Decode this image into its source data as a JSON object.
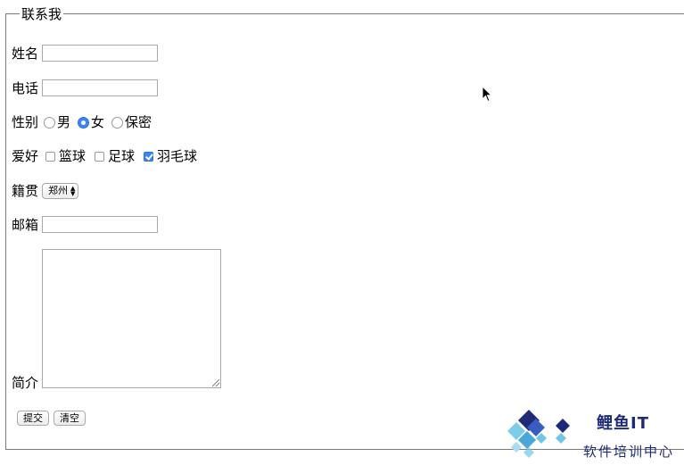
{
  "form": {
    "legend": "联系我",
    "name": {
      "label": "姓名",
      "value": ""
    },
    "phone": {
      "label": "电话",
      "value": ""
    },
    "gender": {
      "label": "性别",
      "options": [
        "男",
        "女",
        "保密"
      ],
      "selected": "女"
    },
    "hobbies": {
      "label": "爱好",
      "options": [
        "篮球",
        "足球",
        "羽毛球"
      ],
      "checked": [
        "羽毛球"
      ]
    },
    "hometown": {
      "label": "籍贯",
      "selected": "郑州"
    },
    "email": {
      "label": "邮箱",
      "value": ""
    },
    "intro": {
      "label": "简介",
      "value": ""
    },
    "submit_label": "提交",
    "reset_label": "清空"
  },
  "watermark": {
    "title": "鲤鱼IT",
    "subtitle": "软件培训中心"
  },
  "colors": {
    "accent": "#3b86f0",
    "logo_dark": "#1e2a78",
    "logo_light": "#6ec6e8"
  }
}
